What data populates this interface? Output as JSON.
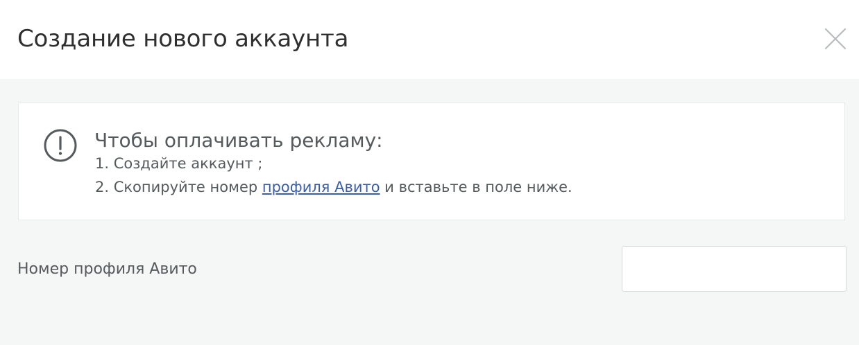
{
  "modal": {
    "title": "Создание нового аккаунта",
    "close_icon": "close-icon"
  },
  "notice": {
    "icon": "exclamation-circle-icon",
    "title": "Чтобы оплачивать рекламу:",
    "step1": "1. Создайте аккаунт ;",
    "step2_prefix": "2. Скопируйте номер ",
    "step2_link": "профиля Авито",
    "step2_suffix": " и вставьте в поле ниже."
  },
  "form": {
    "profile_label": "Номер профиля Авито",
    "profile_value": "",
    "profile_placeholder": ""
  },
  "colors": {
    "body_background": "#f5f7f7",
    "link": "#3a5fa8",
    "text": "#555a5d",
    "title": "#2f2f2f"
  }
}
